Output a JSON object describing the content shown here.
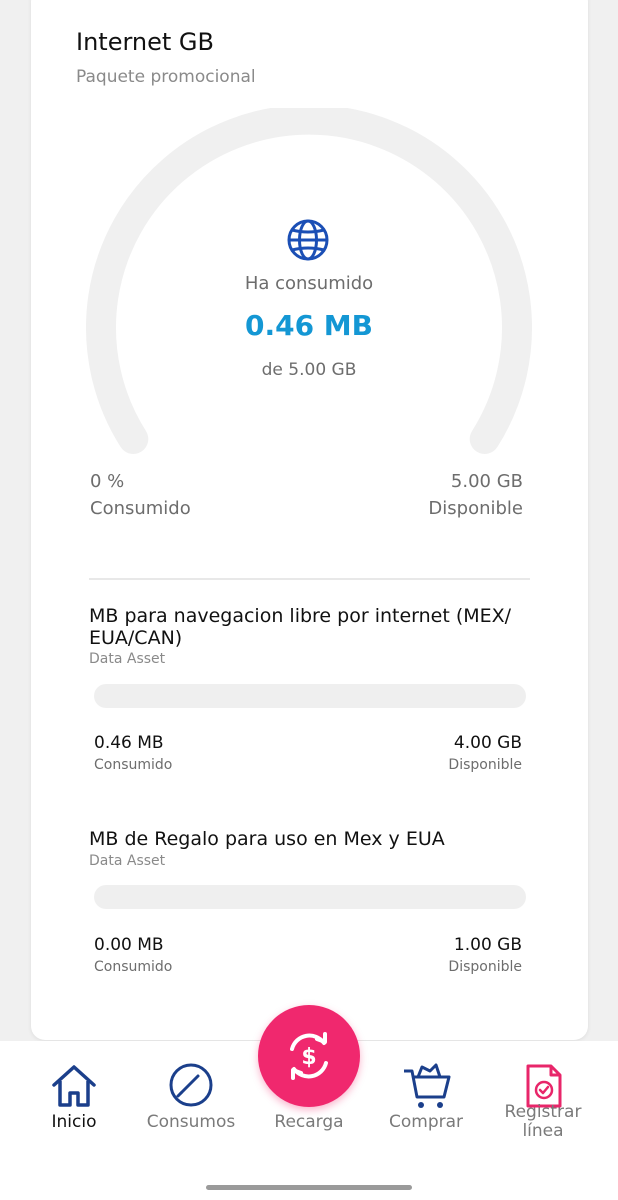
{
  "card": {
    "title": "Internet GB",
    "subtitle": "Paquete promocional"
  },
  "gauge": {
    "consumed_label": "Ha consumido",
    "consumed_value": "0.46 MB",
    "total_label": "de 5.00 GB",
    "left_value": "0 %",
    "left_label": "Consumido",
    "right_value": "5.00 GB",
    "right_label": "Disponible",
    "fraction_used": 0.0001
  },
  "assets": [
    {
      "title": "MB para navegacion libre por internet (MEX/ EUA/CAN)",
      "subtitle": "Data Asset",
      "consumed_value": "0.46 MB",
      "consumed_label": "Consumido",
      "available_value": "4.00 GB",
      "available_label": "Disponible",
      "fraction_used": 0.0001
    },
    {
      "title": "MB de Regalo para uso en Mex y EUA",
      "subtitle": "Data Asset",
      "consumed_value": "0.00 MB",
      "consumed_label": "Consumido",
      "available_value": "1.00 GB",
      "available_label": "Disponible",
      "fraction_used": 0
    }
  ],
  "nav": {
    "items": [
      {
        "label": "Inicio",
        "icon": "home-icon"
      },
      {
        "label": "Consumos",
        "icon": "gauge-icon"
      },
      {
        "label": "Recarga",
        "icon": "recharge-icon"
      },
      {
        "label": "Comprar",
        "icon": "cart-icon"
      },
      {
        "label": "Registrar línea",
        "icon": "register-document-icon"
      }
    ]
  },
  "colors": {
    "accent_blue": "#1497d4",
    "fab_pink": "#f0286e",
    "icon_navy": "#1b3f8b",
    "register_pink": "#e8266a",
    "track_gray": "#efefef"
  }
}
